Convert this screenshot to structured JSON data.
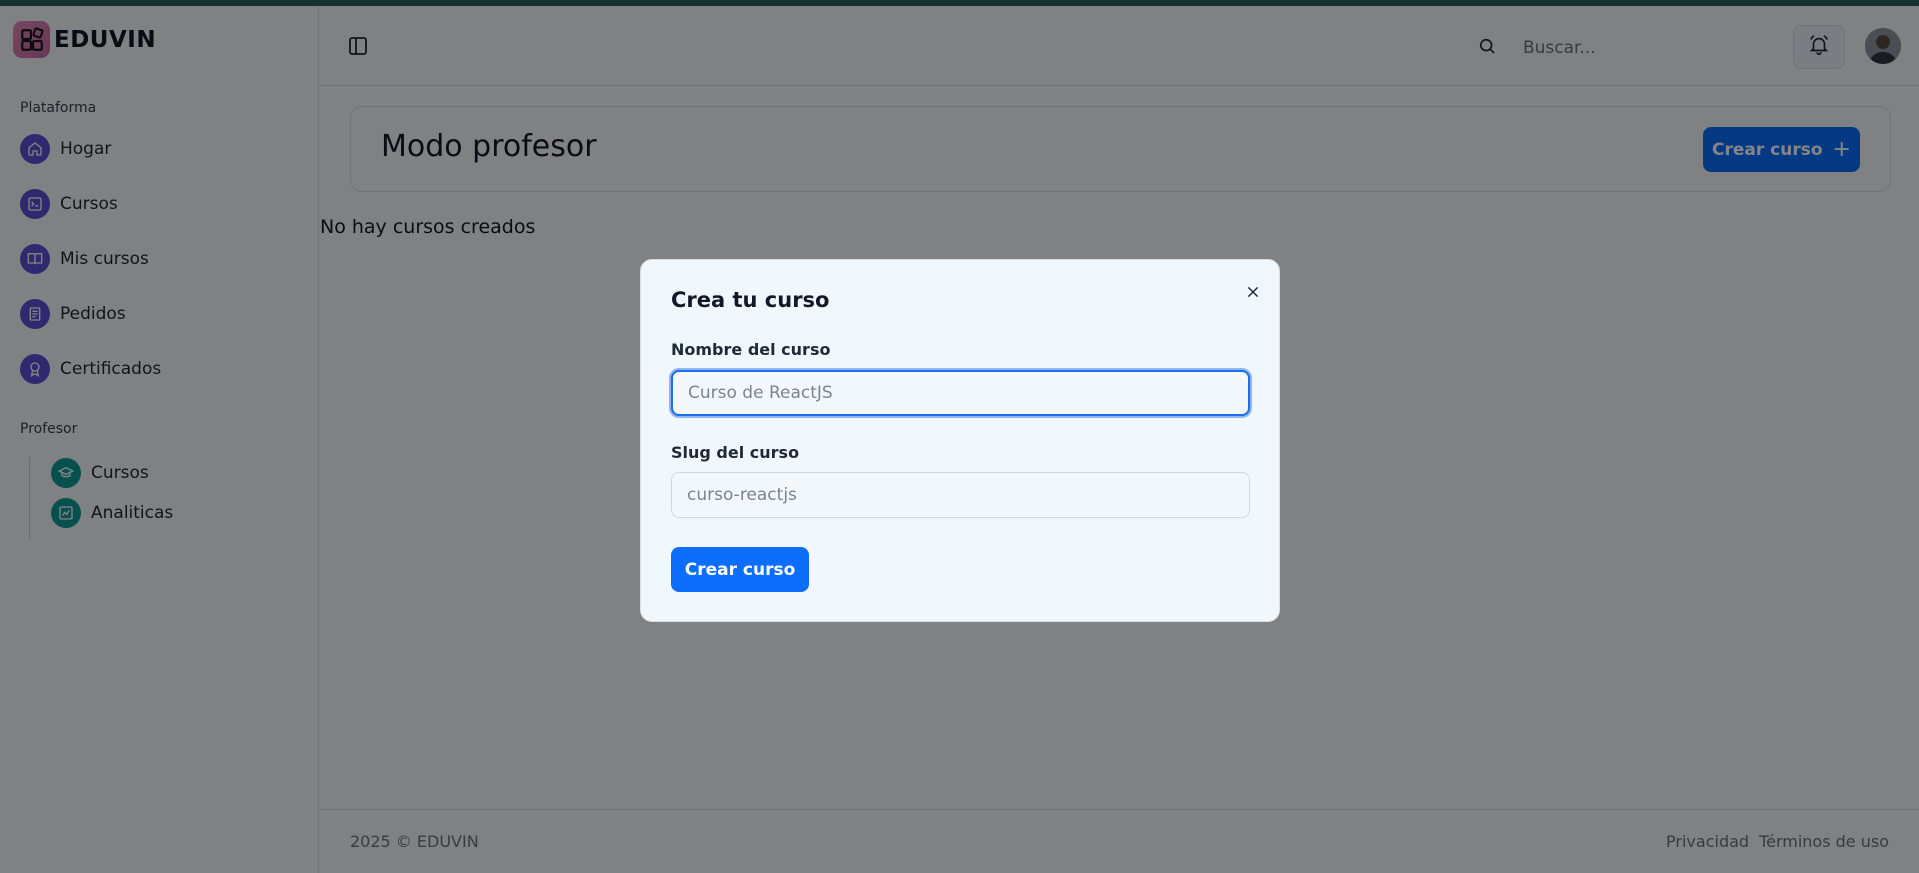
{
  "app": {
    "name": "EDUVIN"
  },
  "sidebar": {
    "platform_label": "Plataforma",
    "platform_items": [
      {
        "label": "Hogar",
        "icon": "home-icon"
      },
      {
        "label": "Cursos",
        "icon": "terminal-icon"
      },
      {
        "label": "Mis cursos",
        "icon": "book-open-icon"
      },
      {
        "label": "Pedidos",
        "icon": "receipt-icon"
      },
      {
        "label": "Certificados",
        "icon": "award-icon"
      }
    ],
    "teacher_label": "Profesor",
    "teacher_items": [
      {
        "label": "Cursos",
        "icon": "graduation-cap-icon"
      },
      {
        "label": "Analiticas",
        "icon": "chart-icon"
      }
    ]
  },
  "header": {
    "search": {
      "placeholder": "Buscar...",
      "value": ""
    }
  },
  "main": {
    "title": "Modo profesor",
    "create_button": "Crear curso",
    "empty_message": "No hay cursos creados"
  },
  "footer": {
    "copyright": "2025 © EDUVIN",
    "links": [
      "Privacidad",
      "Términos de uso"
    ]
  },
  "modal": {
    "title": "Crea tu curso",
    "fields": [
      {
        "label": "Nombre del curso",
        "placeholder": "Curso de ReactJS",
        "value": ""
      },
      {
        "label": "Slug del curso",
        "placeholder": "curso-reactjs",
        "value": ""
      }
    ],
    "submit_label": "Crear curso"
  },
  "colors": {
    "primary": "#0d6efd",
    "platform_icon": "#5b4fd6",
    "teacher_icon": "#0f9a9a",
    "overlay": "rgba(0,0,0,0.48)"
  }
}
